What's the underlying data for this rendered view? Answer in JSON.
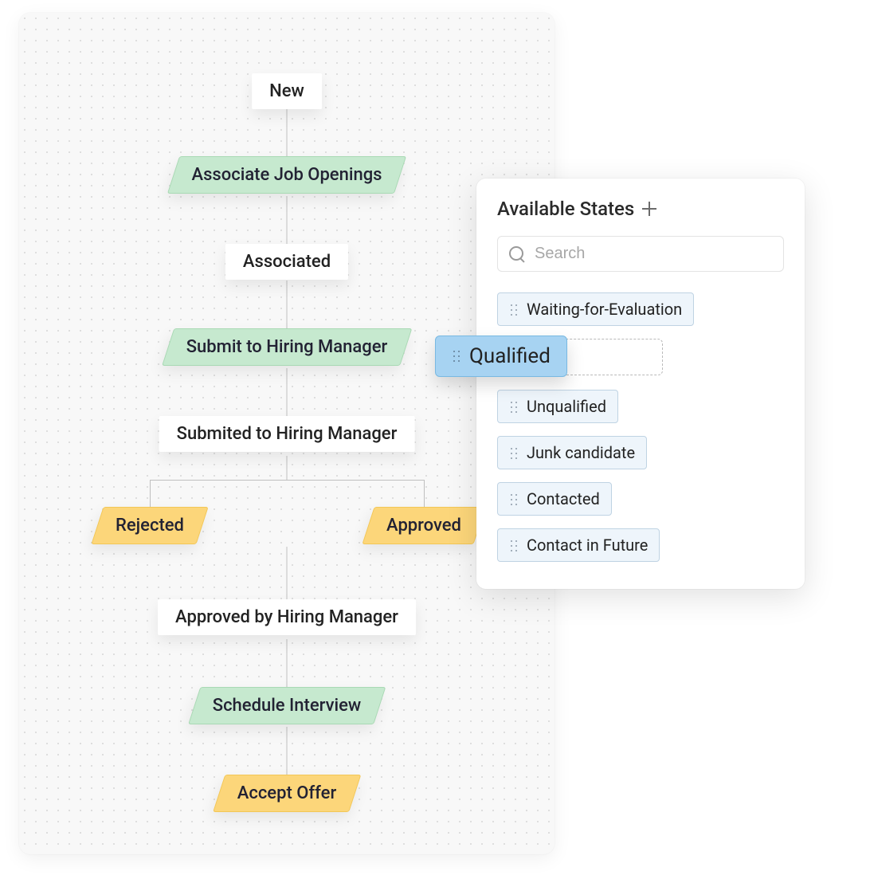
{
  "flow": {
    "nodes": {
      "new": "New",
      "associate_job_openings": "Associate Job Openings",
      "associated": "Associated",
      "submit_to_hiring_manager": "Submit to Hiring Manager",
      "submitted_to_hiring_manager": "Submited to Hiring Manager",
      "rejected": "Rejected",
      "approved": "Approved",
      "approved_by_hiring_manager": "Approved by Hiring Manager",
      "schedule_interview": "Schedule Interview",
      "accept_offer": "Accept Offer"
    }
  },
  "panel": {
    "title": "Available States",
    "search_placeholder": "Search",
    "states": [
      "Waiting-for-Evaluation",
      "Qualified",
      "Unqualified",
      "Junk candidate",
      "Contacted",
      "Contact in Future"
    ],
    "dragging": "Qualified"
  }
}
